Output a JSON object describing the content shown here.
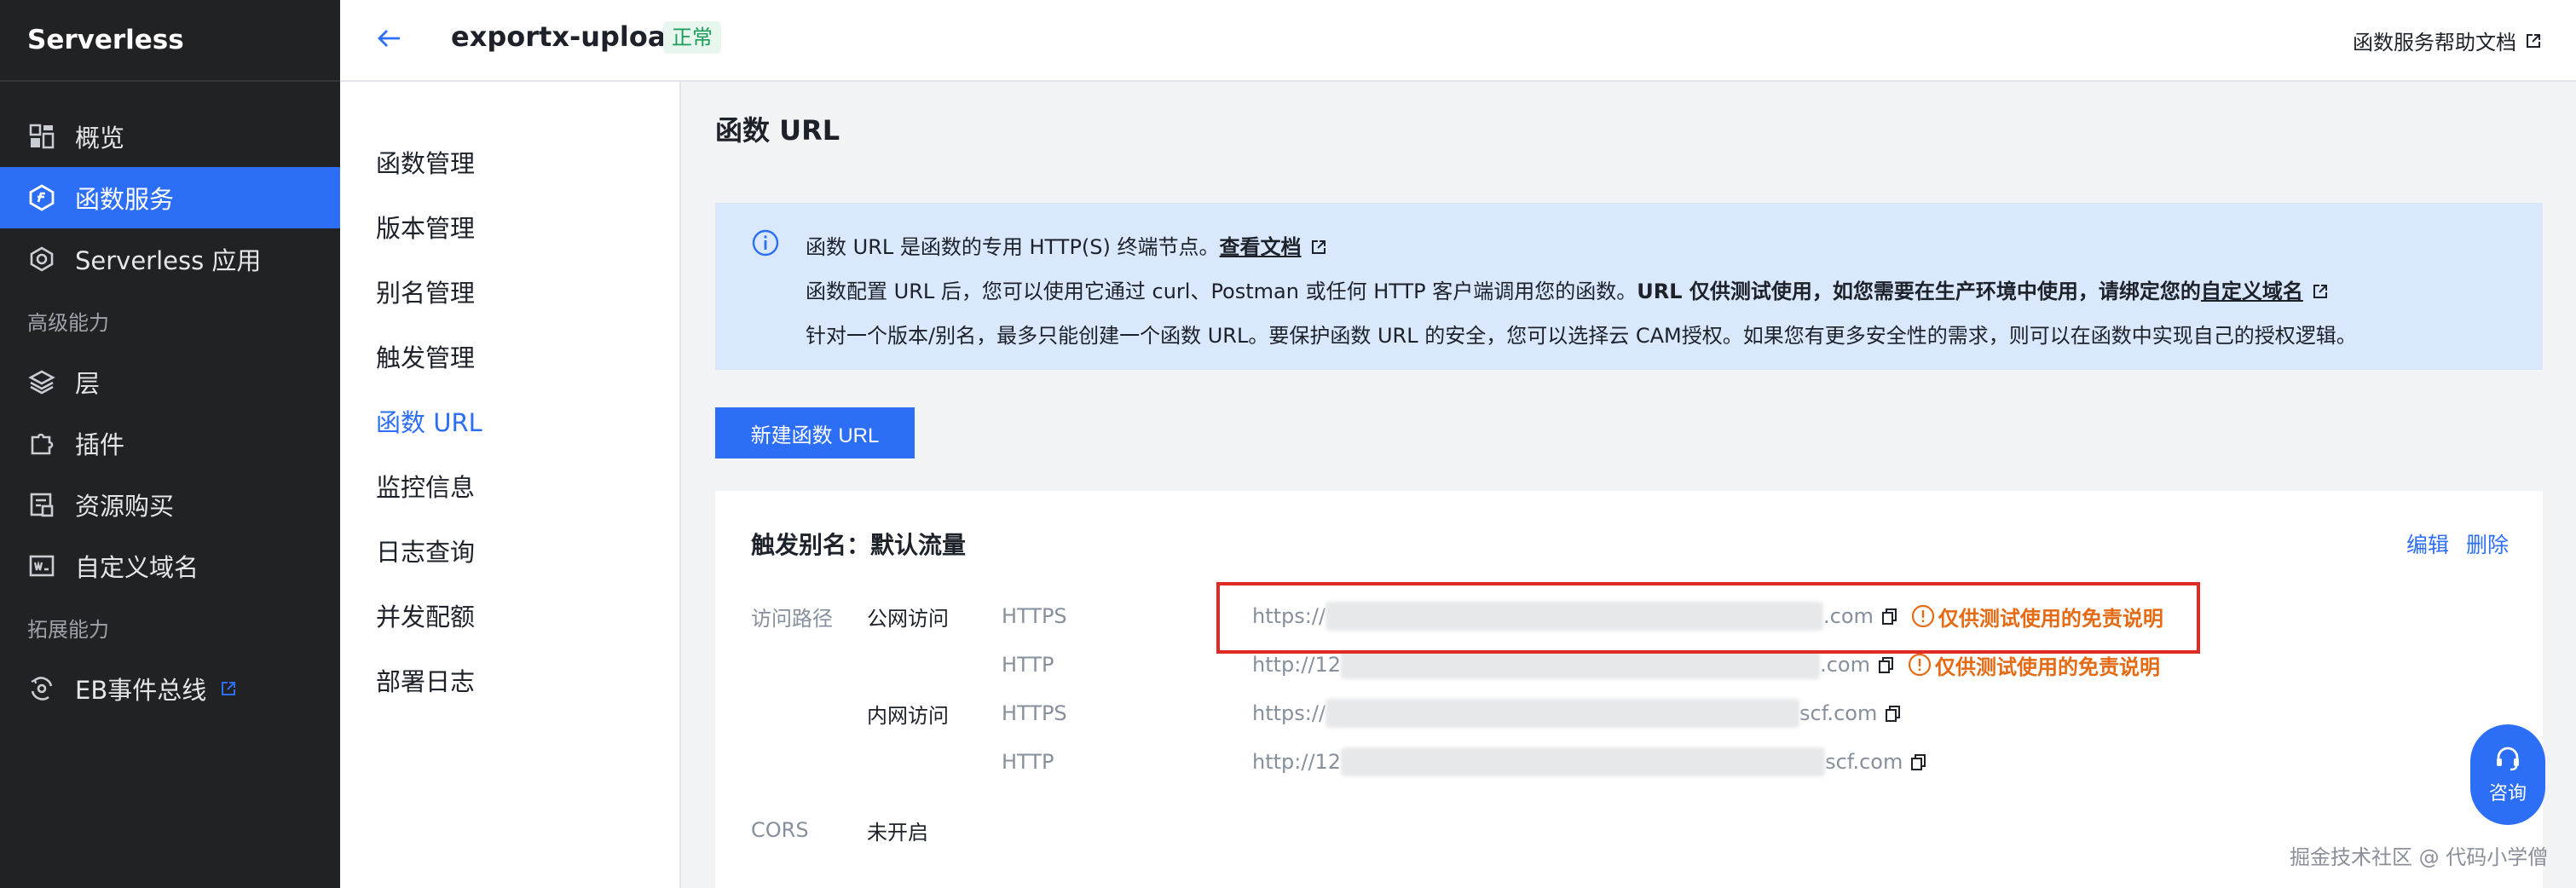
{
  "sidebar": {
    "brand": "Serverless",
    "items": [
      {
        "label": "概览",
        "icon": "grid-icon"
      },
      {
        "label": "函数服务",
        "icon": "function-icon",
        "active": true
      },
      {
        "label": "Serverless 应用",
        "icon": "app-icon"
      }
    ],
    "group_advanced": "高级能力",
    "advanced_items": [
      {
        "label": "层",
        "icon": "layers-icon"
      },
      {
        "label": "插件",
        "icon": "plugin-icon"
      },
      {
        "label": "资源购买",
        "icon": "purchase-icon"
      },
      {
        "label": "自定义域名",
        "icon": "domain-icon"
      }
    ],
    "group_extension": "拓展能力",
    "extension_items": [
      {
        "label": "EB事件总线",
        "icon": "eventbus-icon"
      }
    ]
  },
  "header": {
    "function_name": "exportx-upload",
    "status": "正常",
    "help_doc": "函数服务帮助文档"
  },
  "submenu": {
    "items": [
      "函数管理",
      "版本管理",
      "别名管理",
      "触发管理",
      "函数 URL",
      "监控信息",
      "日志查询",
      "并发配额",
      "部署日志"
    ],
    "active_index": 4
  },
  "main": {
    "title": "函数 URL",
    "info": {
      "line1_text": "函数 URL 是函数的专用 HTTP(S) 终端节点。",
      "line1_link": "查看文档",
      "line2_text": "函数配置 URL 后，您可以使用它通过 curl、Postman 或任何 HTTP 客户端调用您的函数。",
      "line2_bold": "URL 仅供测试使用，如您需要在生产环境中使用，请绑定您的",
      "line2_link": "自定义域名",
      "line3_text": "针对一个版本/别名，最多只能创建一个函数 URL。要保护函数 URL 的安全，您可以选择云 CAM授权。如果您有更多安全性的需求，则可以在函数中实现自己的授权逻辑。"
    },
    "create_button": "新建函数 URL",
    "card": {
      "title": "触发别名：默认流量",
      "edit": "编辑",
      "delete": "删除",
      "access_path_label": "访问路径",
      "public_access": "公网访问",
      "private_access": "内网访问",
      "rows": [
        {
          "proto": "HTTPS",
          "url_prefix": "https://",
          "url_suffix": ".com",
          "warning": "仅供测试使用的免责说明"
        },
        {
          "proto": "HTTP",
          "url_prefix": "http://12",
          "url_suffix": ".com",
          "warning": "仅供测试使用的免责说明"
        },
        {
          "proto": "HTTPS",
          "url_prefix": "https://",
          "url_suffix": "scf.com"
        },
        {
          "proto": "HTTP",
          "url_prefix": "http://12",
          "url_suffix": "scf.com"
        }
      ],
      "cors_label": "CORS",
      "cors_value": "未开启"
    }
  },
  "consult_button": "咨询",
  "watermark": "掘金技术社区 @ 代码小学僧",
  "colors": {
    "primary": "#2c6ef5",
    "sidebar_bg": "#212224",
    "warning": "#e46a13",
    "highlight_border": "#e02b24"
  }
}
